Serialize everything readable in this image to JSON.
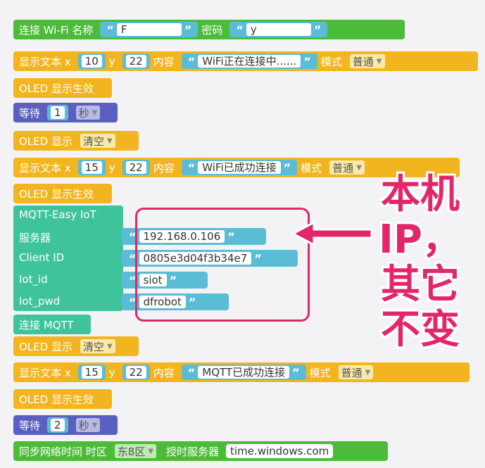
{
  "blocks": {
    "wifi": {
      "label": "连接 Wi-Fi 名称",
      "ssid": "F",
      "pwd_label": "密码",
      "pwd": "y"
    },
    "text1": {
      "label": "显示文本 x",
      "x": "10",
      "y_label": "y",
      "y": "22",
      "content_label": "内容",
      "content": "WiFi正在连接中......",
      "mode_label": "模式",
      "mode": "普通"
    },
    "oled_show1": {
      "label": "OLED 显示生效"
    },
    "wait1": {
      "label": "等待",
      "value": "1",
      "unit": "秒"
    },
    "oled_clear1": {
      "label": "OLED 显示",
      "value": "清空"
    },
    "text2": {
      "label": "显示文本 x",
      "x": "15",
      "y_label": "y",
      "y": "22",
      "content_label": "内容",
      "content": "WiFi已成功连接",
      "mode_label": "模式",
      "mode": "普通"
    },
    "oled_show2": {
      "label": "OLED 显示生效"
    },
    "mqtt": {
      "title": "MQTT-Easy IoT",
      "server_label": "服务器",
      "server": "192.168.0.106",
      "client_label": "Client ID",
      "client": "0805e3d04f3b34e7",
      "iot_id_label": "Iot_id",
      "iot_id": "siot",
      "iot_pwd_label": "Iot_pwd",
      "iot_pwd": "dfrobot"
    },
    "connect_mqtt": {
      "label": "连接 MQTT"
    },
    "oled_clear2": {
      "label": "OLED 显示",
      "value": "清空"
    },
    "text3": {
      "label": "显示文本 x",
      "x": "15",
      "y_label": "y",
      "y": "22",
      "content_label": "内容",
      "content": "MQTT已成功连接",
      "mode_label": "模式",
      "mode": "普通"
    },
    "oled_show3": {
      "label": "OLED 显示生效"
    },
    "wait2": {
      "label": "等待",
      "value": "2",
      "unit": "秒"
    },
    "sync": {
      "label": "同步网络时间 时区",
      "zone": "东8区",
      "server_label": "授时服务器",
      "server": "time.windows.com"
    }
  },
  "quote_open": "“",
  "quote_close": "”",
  "annotation": "本机IP，其它不变",
  "annotation_lines": [
    "本机",
    "IP，",
    "其它",
    "不变"
  ]
}
